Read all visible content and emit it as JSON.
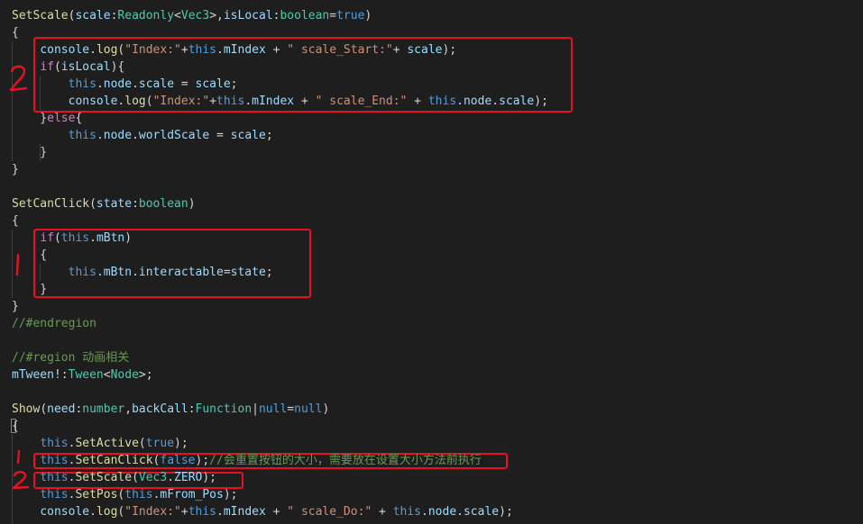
{
  "editor": {
    "lines": [
      {
        "tokens": [
          {
            "t": "SetScale",
            "c": "fn"
          },
          {
            "t": "(",
            "c": "pl"
          },
          {
            "t": "scale",
            "c": "pm"
          },
          {
            "t": ":",
            "c": "pl"
          },
          {
            "t": "Readonly",
            "c": "ty"
          },
          {
            "t": "<",
            "c": "pl"
          },
          {
            "t": "Vec3",
            "c": "ty"
          },
          {
            "t": ">,",
            "c": "pl"
          },
          {
            "t": "isLocal",
            "c": "pm"
          },
          {
            "t": ":",
            "c": "pl"
          },
          {
            "t": "boolean",
            "c": "ty"
          },
          {
            "t": "=",
            "c": "pl"
          },
          {
            "t": "true",
            "c": "kw"
          },
          {
            "t": ")",
            "c": "pl"
          }
        ]
      },
      {
        "tokens": [
          {
            "t": "{",
            "c": "pl"
          }
        ]
      },
      {
        "tokens": [
          {
            "t": "    ",
            "c": "pl"
          },
          {
            "t": "console",
            "c": "pm"
          },
          {
            "t": ".",
            "c": "pl"
          },
          {
            "t": "log",
            "c": "fn"
          },
          {
            "t": "(",
            "c": "pl"
          },
          {
            "t": "\"Index:\"",
            "c": "st"
          },
          {
            "t": "+",
            "c": "pl"
          },
          {
            "t": "this",
            "c": "kw"
          },
          {
            "t": ".",
            "c": "pl"
          },
          {
            "t": "mIndex",
            "c": "pm"
          },
          {
            "t": " + ",
            "c": "pl"
          },
          {
            "t": "\" scale_Start:\"",
            "c": "st"
          },
          {
            "t": "+ ",
            "c": "pl"
          },
          {
            "t": "scale",
            "c": "pm"
          },
          {
            "t": ");",
            "c": "pl"
          }
        ]
      },
      {
        "tokens": [
          {
            "t": "    ",
            "c": "pl"
          },
          {
            "t": "if",
            "c": "cf"
          },
          {
            "t": "(",
            "c": "pl"
          },
          {
            "t": "isLocal",
            "c": "pm"
          },
          {
            "t": "){",
            "c": "pl"
          }
        ]
      },
      {
        "tokens": [
          {
            "t": "        ",
            "c": "pl"
          },
          {
            "t": "this",
            "c": "kw"
          },
          {
            "t": ".",
            "c": "pl"
          },
          {
            "t": "node",
            "c": "pm"
          },
          {
            "t": ".",
            "c": "pl"
          },
          {
            "t": "scale",
            "c": "pm"
          },
          {
            "t": " = ",
            "c": "pl"
          },
          {
            "t": "scale",
            "c": "pm"
          },
          {
            "t": ";",
            "c": "pl"
          }
        ]
      },
      {
        "tokens": [
          {
            "t": "        ",
            "c": "pl"
          },
          {
            "t": "console",
            "c": "pm"
          },
          {
            "t": ".",
            "c": "pl"
          },
          {
            "t": "log",
            "c": "fn"
          },
          {
            "t": "(",
            "c": "pl"
          },
          {
            "t": "\"Index:\"",
            "c": "st"
          },
          {
            "t": "+",
            "c": "pl"
          },
          {
            "t": "this",
            "c": "kw"
          },
          {
            "t": ".",
            "c": "pl"
          },
          {
            "t": "mIndex",
            "c": "pm"
          },
          {
            "t": " + ",
            "c": "pl"
          },
          {
            "t": "\" scale_End:\"",
            "c": "st"
          },
          {
            "t": " + ",
            "c": "pl"
          },
          {
            "t": "this",
            "c": "kw"
          },
          {
            "t": ".",
            "c": "pl"
          },
          {
            "t": "node",
            "c": "pm"
          },
          {
            "t": ".",
            "c": "pl"
          },
          {
            "t": "scale",
            "c": "pm"
          },
          {
            "t": ");",
            "c": "pl"
          }
        ]
      },
      {
        "tokens": [
          {
            "t": "    }",
            "c": "pl"
          },
          {
            "t": "else",
            "c": "cf"
          },
          {
            "t": "{",
            "c": "pl"
          }
        ]
      },
      {
        "tokens": [
          {
            "t": "        ",
            "c": "pl"
          },
          {
            "t": "this",
            "c": "kw"
          },
          {
            "t": ".",
            "c": "pl"
          },
          {
            "t": "node",
            "c": "pm"
          },
          {
            "t": ".",
            "c": "pl"
          },
          {
            "t": "worldScale",
            "c": "pm"
          },
          {
            "t": " = ",
            "c": "pl"
          },
          {
            "t": "scale",
            "c": "pm"
          },
          {
            "t": ";",
            "c": "pl"
          }
        ]
      },
      {
        "tokens": [
          {
            "t": "    }",
            "c": "pl"
          }
        ]
      },
      {
        "tokens": [
          {
            "t": "}",
            "c": "pl"
          }
        ]
      },
      {
        "tokens": []
      },
      {
        "tokens": [
          {
            "t": "SetCanClick",
            "c": "fn"
          },
          {
            "t": "(",
            "c": "pl"
          },
          {
            "t": "state",
            "c": "pm"
          },
          {
            "t": ":",
            "c": "pl"
          },
          {
            "t": "boolean",
            "c": "ty"
          },
          {
            "t": ")",
            "c": "pl"
          }
        ]
      },
      {
        "tokens": [
          {
            "t": "{",
            "c": "pl"
          }
        ]
      },
      {
        "tokens": [
          {
            "t": "    ",
            "c": "pl"
          },
          {
            "t": "if",
            "c": "cf"
          },
          {
            "t": "(",
            "c": "pl"
          },
          {
            "t": "this",
            "c": "kw"
          },
          {
            "t": ".",
            "c": "pl"
          },
          {
            "t": "mBtn",
            "c": "pm"
          },
          {
            "t": ")",
            "c": "pl"
          }
        ]
      },
      {
        "tokens": [
          {
            "t": "    {",
            "c": "pl"
          }
        ]
      },
      {
        "tokens": [
          {
            "t": "        ",
            "c": "pl"
          },
          {
            "t": "this",
            "c": "kw"
          },
          {
            "t": ".",
            "c": "pl"
          },
          {
            "t": "mBtn",
            "c": "pm"
          },
          {
            "t": ".",
            "c": "pl"
          },
          {
            "t": "interactable",
            "c": "pm"
          },
          {
            "t": "=",
            "c": "pl"
          },
          {
            "t": "state",
            "c": "pm"
          },
          {
            "t": ";",
            "c": "pl"
          }
        ]
      },
      {
        "tokens": [
          {
            "t": "    }",
            "c": "pl"
          }
        ]
      },
      {
        "tokens": [
          {
            "t": "}",
            "c": "pl"
          }
        ]
      },
      {
        "tokens": [
          {
            "t": "//#endregion",
            "c": "cm"
          }
        ]
      },
      {
        "tokens": []
      },
      {
        "tokens": [
          {
            "t": "//#region 动画相关",
            "c": "cm"
          }
        ]
      },
      {
        "tokens": [
          {
            "t": "mTween",
            "c": "pm"
          },
          {
            "t": "!:",
            "c": "pl"
          },
          {
            "t": "Tween",
            "c": "ty"
          },
          {
            "t": "<",
            "c": "pl"
          },
          {
            "t": "Node",
            "c": "ty"
          },
          {
            "t": ">;",
            "c": "pl"
          }
        ]
      },
      {
        "tokens": []
      },
      {
        "tokens": [
          {
            "t": "Show",
            "c": "fn"
          },
          {
            "t": "(",
            "c": "pl"
          },
          {
            "t": "need",
            "c": "pm"
          },
          {
            "t": ":",
            "c": "pl"
          },
          {
            "t": "number",
            "c": "ty"
          },
          {
            "t": ",",
            "c": "pl"
          },
          {
            "t": "backCall",
            "c": "pm"
          },
          {
            "t": ":",
            "c": "pl"
          },
          {
            "t": "Function",
            "c": "ty"
          },
          {
            "t": "|",
            "c": "pl"
          },
          {
            "t": "null",
            "c": "kw"
          },
          {
            "t": "=",
            "c": "pl"
          },
          {
            "t": "null",
            "c": "kw"
          },
          {
            "t": ")",
            "c": "pl"
          }
        ]
      },
      {
        "tokens": [
          {
            "t": "{",
            "c": "pl"
          }
        ]
      },
      {
        "tokens": [
          {
            "t": "    ",
            "c": "pl"
          },
          {
            "t": "this",
            "c": "kw"
          },
          {
            "t": ".",
            "c": "pl"
          },
          {
            "t": "SetActive",
            "c": "fn"
          },
          {
            "t": "(",
            "c": "pl"
          },
          {
            "t": "true",
            "c": "kw"
          },
          {
            "t": ");",
            "c": "pl"
          }
        ]
      },
      {
        "tokens": [
          {
            "t": "    ",
            "c": "pl"
          },
          {
            "t": "this",
            "c": "kw"
          },
          {
            "t": ".",
            "c": "pl"
          },
          {
            "t": "SetCanClick",
            "c": "fn"
          },
          {
            "t": "(",
            "c": "pl"
          },
          {
            "t": "false",
            "c": "kw"
          },
          {
            "t": ");",
            "c": "pl"
          },
          {
            "t": "//会重置按钮的大小，需要放在设置大小方法前执行",
            "c": "cm"
          }
        ]
      },
      {
        "tokens": [
          {
            "t": "    ",
            "c": "pl"
          },
          {
            "t": "this",
            "c": "kw"
          },
          {
            "t": ".",
            "c": "pl"
          },
          {
            "t": "SetScale",
            "c": "fn"
          },
          {
            "t": "(",
            "c": "pl"
          },
          {
            "t": "Vec3",
            "c": "ty"
          },
          {
            "t": ".",
            "c": "pl"
          },
          {
            "t": "ZERO",
            "c": "pm"
          },
          {
            "t": ");",
            "c": "pl"
          }
        ]
      },
      {
        "tokens": [
          {
            "t": "    ",
            "c": "pl"
          },
          {
            "t": "this",
            "c": "kw"
          },
          {
            "t": ".",
            "c": "pl"
          },
          {
            "t": "SetPos",
            "c": "fn"
          },
          {
            "t": "(",
            "c": "pl"
          },
          {
            "t": "this",
            "c": "kw"
          },
          {
            "t": ".",
            "c": "pl"
          },
          {
            "t": "mFrom_Pos",
            "c": "pm"
          },
          {
            "t": ");",
            "c": "pl"
          }
        ]
      },
      {
        "tokens": [
          {
            "t": "    ",
            "c": "pl"
          },
          {
            "t": "console",
            "c": "pm"
          },
          {
            "t": ".",
            "c": "pl"
          },
          {
            "t": "log",
            "c": "fn"
          },
          {
            "t": "(",
            "c": "pl"
          },
          {
            "t": "\"Index:\"",
            "c": "st"
          },
          {
            "t": "+",
            "c": "pl"
          },
          {
            "t": "this",
            "c": "kw"
          },
          {
            "t": ".",
            "c": "pl"
          },
          {
            "t": "mIndex",
            "c": "pm"
          },
          {
            "t": " + ",
            "c": "pl"
          },
          {
            "t": "\" scale_Do:\"",
            "c": "st"
          },
          {
            "t": " + ",
            "c": "pl"
          },
          {
            "t": "this",
            "c": "kw"
          },
          {
            "t": ".",
            "c": "pl"
          },
          {
            "t": "node",
            "c": "pm"
          },
          {
            "t": ".",
            "c": "pl"
          },
          {
            "t": "scale",
            "c": "pm"
          },
          {
            "t": ");",
            "c": "pl"
          }
        ]
      }
    ]
  },
  "annotations": {
    "mark_2": "2",
    "mark_1": "1",
    "annotation_color": "#e81123"
  }
}
